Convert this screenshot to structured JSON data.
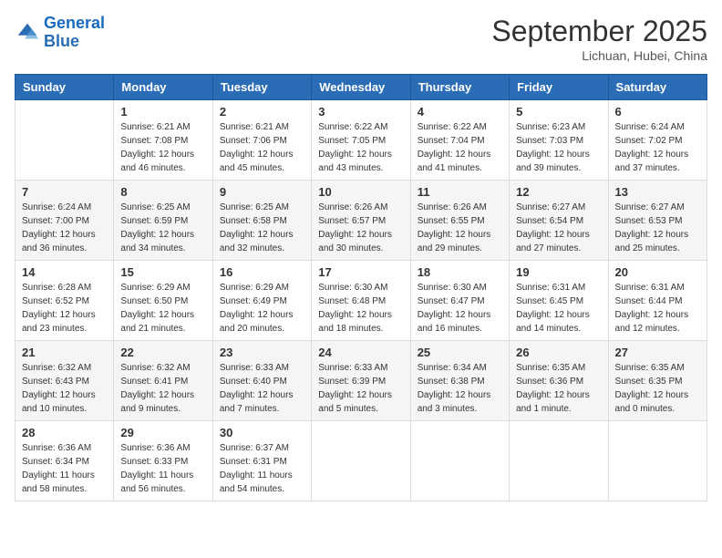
{
  "logo": {
    "line1": "General",
    "line2": "Blue"
  },
  "title": "September 2025",
  "subtitle": "Lichuan, Hubei, China",
  "days_of_week": [
    "Sunday",
    "Monday",
    "Tuesday",
    "Wednesday",
    "Thursday",
    "Friday",
    "Saturday"
  ],
  "weeks": [
    [
      {
        "day": "",
        "sunrise": "",
        "sunset": "",
        "daylight": ""
      },
      {
        "day": "1",
        "sunrise": "Sunrise: 6:21 AM",
        "sunset": "Sunset: 7:08 PM",
        "daylight": "Daylight: 12 hours and 46 minutes."
      },
      {
        "day": "2",
        "sunrise": "Sunrise: 6:21 AM",
        "sunset": "Sunset: 7:06 PM",
        "daylight": "Daylight: 12 hours and 45 minutes."
      },
      {
        "day": "3",
        "sunrise": "Sunrise: 6:22 AM",
        "sunset": "Sunset: 7:05 PM",
        "daylight": "Daylight: 12 hours and 43 minutes."
      },
      {
        "day": "4",
        "sunrise": "Sunrise: 6:22 AM",
        "sunset": "Sunset: 7:04 PM",
        "daylight": "Daylight: 12 hours and 41 minutes."
      },
      {
        "day": "5",
        "sunrise": "Sunrise: 6:23 AM",
        "sunset": "Sunset: 7:03 PM",
        "daylight": "Daylight: 12 hours and 39 minutes."
      },
      {
        "day": "6",
        "sunrise": "Sunrise: 6:24 AM",
        "sunset": "Sunset: 7:02 PM",
        "daylight": "Daylight: 12 hours and 37 minutes."
      }
    ],
    [
      {
        "day": "7",
        "sunrise": "Sunrise: 6:24 AM",
        "sunset": "Sunset: 7:00 PM",
        "daylight": "Daylight: 12 hours and 36 minutes."
      },
      {
        "day": "8",
        "sunrise": "Sunrise: 6:25 AM",
        "sunset": "Sunset: 6:59 PM",
        "daylight": "Daylight: 12 hours and 34 minutes."
      },
      {
        "day": "9",
        "sunrise": "Sunrise: 6:25 AM",
        "sunset": "Sunset: 6:58 PM",
        "daylight": "Daylight: 12 hours and 32 minutes."
      },
      {
        "day": "10",
        "sunrise": "Sunrise: 6:26 AM",
        "sunset": "Sunset: 6:57 PM",
        "daylight": "Daylight: 12 hours and 30 minutes."
      },
      {
        "day": "11",
        "sunrise": "Sunrise: 6:26 AM",
        "sunset": "Sunset: 6:55 PM",
        "daylight": "Daylight: 12 hours and 29 minutes."
      },
      {
        "day": "12",
        "sunrise": "Sunrise: 6:27 AM",
        "sunset": "Sunset: 6:54 PM",
        "daylight": "Daylight: 12 hours and 27 minutes."
      },
      {
        "day": "13",
        "sunrise": "Sunrise: 6:27 AM",
        "sunset": "Sunset: 6:53 PM",
        "daylight": "Daylight: 12 hours and 25 minutes."
      }
    ],
    [
      {
        "day": "14",
        "sunrise": "Sunrise: 6:28 AM",
        "sunset": "Sunset: 6:52 PM",
        "daylight": "Daylight: 12 hours and 23 minutes."
      },
      {
        "day": "15",
        "sunrise": "Sunrise: 6:29 AM",
        "sunset": "Sunset: 6:50 PM",
        "daylight": "Daylight: 12 hours and 21 minutes."
      },
      {
        "day": "16",
        "sunrise": "Sunrise: 6:29 AM",
        "sunset": "Sunset: 6:49 PM",
        "daylight": "Daylight: 12 hours and 20 minutes."
      },
      {
        "day": "17",
        "sunrise": "Sunrise: 6:30 AM",
        "sunset": "Sunset: 6:48 PM",
        "daylight": "Daylight: 12 hours and 18 minutes."
      },
      {
        "day": "18",
        "sunrise": "Sunrise: 6:30 AM",
        "sunset": "Sunset: 6:47 PM",
        "daylight": "Daylight: 12 hours and 16 minutes."
      },
      {
        "day": "19",
        "sunrise": "Sunrise: 6:31 AM",
        "sunset": "Sunset: 6:45 PM",
        "daylight": "Daylight: 12 hours and 14 minutes."
      },
      {
        "day": "20",
        "sunrise": "Sunrise: 6:31 AM",
        "sunset": "Sunset: 6:44 PM",
        "daylight": "Daylight: 12 hours and 12 minutes."
      }
    ],
    [
      {
        "day": "21",
        "sunrise": "Sunrise: 6:32 AM",
        "sunset": "Sunset: 6:43 PM",
        "daylight": "Daylight: 12 hours and 10 minutes."
      },
      {
        "day": "22",
        "sunrise": "Sunrise: 6:32 AM",
        "sunset": "Sunset: 6:41 PM",
        "daylight": "Daylight: 12 hours and 9 minutes."
      },
      {
        "day": "23",
        "sunrise": "Sunrise: 6:33 AM",
        "sunset": "Sunset: 6:40 PM",
        "daylight": "Daylight: 12 hours and 7 minutes."
      },
      {
        "day": "24",
        "sunrise": "Sunrise: 6:33 AM",
        "sunset": "Sunset: 6:39 PM",
        "daylight": "Daylight: 12 hours and 5 minutes."
      },
      {
        "day": "25",
        "sunrise": "Sunrise: 6:34 AM",
        "sunset": "Sunset: 6:38 PM",
        "daylight": "Daylight: 12 hours and 3 minutes."
      },
      {
        "day": "26",
        "sunrise": "Sunrise: 6:35 AM",
        "sunset": "Sunset: 6:36 PM",
        "daylight": "Daylight: 12 hours and 1 minute."
      },
      {
        "day": "27",
        "sunrise": "Sunrise: 6:35 AM",
        "sunset": "Sunset: 6:35 PM",
        "daylight": "Daylight: 12 hours and 0 minutes."
      }
    ],
    [
      {
        "day": "28",
        "sunrise": "Sunrise: 6:36 AM",
        "sunset": "Sunset: 6:34 PM",
        "daylight": "Daylight: 11 hours and 58 minutes."
      },
      {
        "day": "29",
        "sunrise": "Sunrise: 6:36 AM",
        "sunset": "Sunset: 6:33 PM",
        "daylight": "Daylight: 11 hours and 56 minutes."
      },
      {
        "day": "30",
        "sunrise": "Sunrise: 6:37 AM",
        "sunset": "Sunset: 6:31 PM",
        "daylight": "Daylight: 11 hours and 54 minutes."
      },
      {
        "day": "",
        "sunrise": "",
        "sunset": "",
        "daylight": ""
      },
      {
        "day": "",
        "sunrise": "",
        "sunset": "",
        "daylight": ""
      },
      {
        "day": "",
        "sunrise": "",
        "sunset": "",
        "daylight": ""
      },
      {
        "day": "",
        "sunrise": "",
        "sunset": "",
        "daylight": ""
      }
    ]
  ]
}
